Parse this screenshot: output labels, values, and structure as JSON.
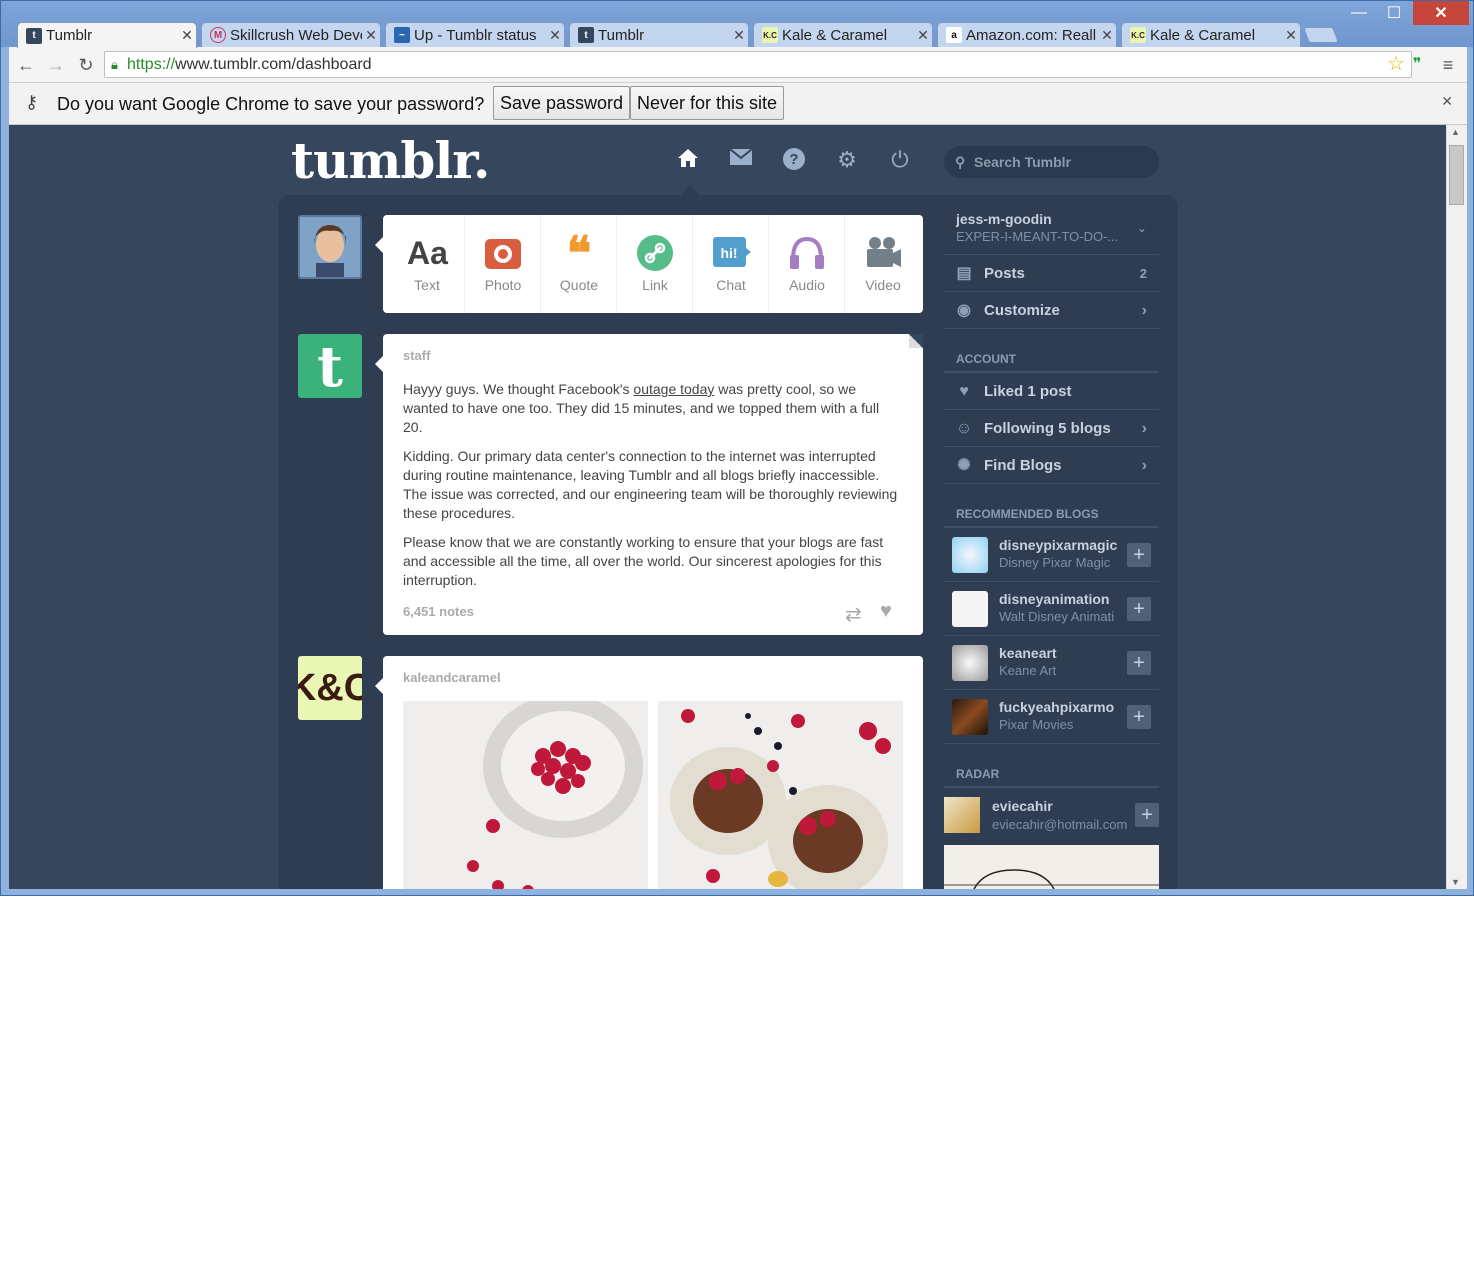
{
  "browser": {
    "tabs": [
      {
        "title": "Tumblr",
        "favicon": "t",
        "active": true
      },
      {
        "title": "Skillcrush Web Deve",
        "favicon": "M"
      },
      {
        "title": "Up - Tumblr status",
        "favicon": "~"
      },
      {
        "title": "Tumblr",
        "favicon": "t"
      },
      {
        "title": "Kale & Caramel",
        "favicon": "K.C"
      },
      {
        "title": "Amazon.com: Reall",
        "favicon": "a"
      },
      {
        "title": "Kale & Caramel",
        "favicon": "K.C"
      }
    ],
    "url_scheme": "https://",
    "url_rest": "www.tumblr.com/dashboard",
    "password_prompt": "Do you want Google Chrome to save your password?",
    "save_password": "Save password",
    "never_for_site": "Never for this site"
  },
  "tumblr": {
    "logo": "tumblr.",
    "search_placeholder": "Search Tumblr",
    "post_types": [
      {
        "label": "Text",
        "icon": "Aa",
        "color": "#444444"
      },
      {
        "label": "Photo",
        "icon": "camera",
        "color": "#d95e40"
      },
      {
        "label": "Quote",
        "icon": "66",
        "color": "#f2992e"
      },
      {
        "label": "Link",
        "icon": "link",
        "color": "#56bc8a"
      },
      {
        "label": "Chat",
        "icon": "hi!",
        "color": "#529ecc"
      },
      {
        "label": "Audio",
        "icon": "headphones",
        "color": "#a77dc2"
      },
      {
        "label": "Video",
        "icon": "camera-video",
        "color": "#748089"
      }
    ],
    "staff_post": {
      "author": "staff",
      "p1_a": "Hayyy guys. We thought Facebook's ",
      "p1_link": "outage today",
      "p1_b": " was pretty cool, so we wanted to have one too. They did 15 minutes, and we topped them with a full 20.",
      "p2": "Kidding. Our primary data center's connection to the internet was interrupted during routine maintenance, leaving Tumblr and all blogs briefly inaccessible. The issue was corrected, and our engineering team will be thoroughly reviewing these procedures.",
      "p3": "Please know that we are constantly working to ensure that your blogs are fast and accessible all the time, all over the world. Our sincerest apologies for this interruption.",
      "notes": "6,451 notes"
    },
    "kale_post": {
      "author": "kaleandcaramel",
      "avatar_text": "K&C"
    },
    "sidebar": {
      "blog_name": "jess-m-goodin",
      "blog_title": "EXPER-I-MEANT-TO-DO-...",
      "posts_label": "Posts",
      "posts_count": "2",
      "customize_label": "Customize",
      "account_header": "ACCOUNT",
      "liked_label": "Liked 1 post",
      "following_label": "Following 5 blogs",
      "find_label": "Find Blogs",
      "recommended_header": "RECOMMENDED BLOGS",
      "recommended": [
        {
          "name": "disneypixarmagic",
          "title": "Disney Pixar Magic"
        },
        {
          "name": "disneyanimation",
          "title": "Walt Disney Animati"
        },
        {
          "name": "keaneart",
          "title": "Keane Art"
        },
        {
          "name": "fuckyeahpixarmo",
          "title": "Pixar Movies"
        }
      ],
      "radar_header": "RADAR",
      "radar": {
        "name": "eviecahir",
        "title": "eviecahir@hotmail.com"
      }
    }
  }
}
